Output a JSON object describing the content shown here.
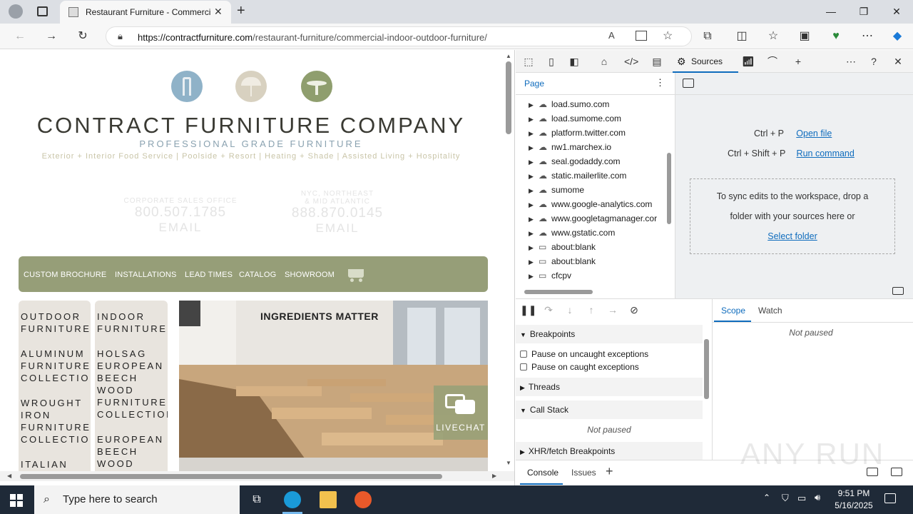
{
  "browser": {
    "tab_title": "Restaurant Furniture - Commercial",
    "url_host": "https://contractfurniture.com",
    "url_path": "/restaurant-furniture/commercial-indoor-outdoor-furniture/"
  },
  "site": {
    "company_name": "CONTRACT FURNITURE COMPANY",
    "subtitle": "PROFESSIONAL GRADE FURNITURE",
    "tagline": "Exterior + Interior Food Service | Poolside + Resort | Heating + Shade | Assisted Living + Hospitality",
    "office1": {
      "label": "CORPORATE SALES OFFICE",
      "phone": "800.507.1785",
      "email": "EMAIL"
    },
    "office2": {
      "label1": "NYC, NORTHEAST",
      "label2": "& MID ATLANTIC",
      "phone": "888.870.0145",
      "email": "EMAIL"
    },
    "menu": [
      "CUSTOM BROCHURE",
      "INSTALLATIONS",
      "LEAD TIMES",
      "CATALOG",
      "SHOWROOM"
    ],
    "outdoor_col": [
      "OUTDOOR FURNITURE",
      "ALUMINUM FURNITURE COLLECTIONS",
      "WROUGHT IRON FURNITURE COLLECTIONS",
      "ITALIAN"
    ],
    "indoor_col": [
      "INDOOR FURNITURE",
      "HOLSAG EUROPEAN BEECH WOOD FURNITURE COLLECTION",
      "EUROPEAN BEECH WOOD"
    ],
    "hero_sign": "INGREDIENTS MATTER",
    "livechat": "LIVECHAT"
  },
  "devtools": {
    "sources_tab": "Sources",
    "page_tab": "Page",
    "tree": [
      "load.sumo.com",
      "load.sumome.com",
      "platform.twitter.com",
      "nw1.marchex.io",
      "seal.godaddy.com",
      "static.mailerlite.com",
      "sumome",
      "www.google-analytics.com",
      "www.googletagmanager.cor",
      "www.gstatic.com",
      "about:blank",
      "about:blank",
      "cfcpv"
    ],
    "shortcut1_keys": "Ctrl + P",
    "shortcut1_label": "Open file",
    "shortcut2_keys": "Ctrl + Shift + P",
    "shortcut2_label": "Run command",
    "workspace_text1": "To sync edits to the workspace, drop a",
    "workspace_text2": "folder with your sources here or",
    "select_folder": "Select folder",
    "breakpoints": "Breakpoints",
    "pause_uncaught": "Pause on uncaught exceptions",
    "pause_caught": "Pause on caught exceptions",
    "threads": "Threads",
    "call_stack": "Call Stack",
    "not_paused": "Not paused",
    "xhr": "XHR/fetch Breakpoints",
    "scope_tab": "Scope",
    "watch_tab": "Watch",
    "console_tab": "Console",
    "issues_tab": "Issues"
  },
  "taskbar": {
    "search_placeholder": "Type here to search",
    "time": "9:51 PM",
    "date": "5/16/2025"
  },
  "watermark": "ANY RUN"
}
